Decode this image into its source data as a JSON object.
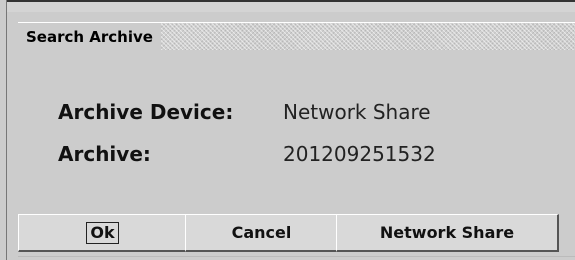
{
  "dialog": {
    "title": "Search Archive"
  },
  "fields": [
    {
      "label": "Archive Device:",
      "value": "Network Share"
    },
    {
      "label": "Archive:",
      "value": "201209251532"
    }
  ],
  "buttons": {
    "ok_label": "Ok",
    "cancel_label": "Cancel",
    "network_share_label": "Network Share"
  },
  "colors": {
    "background": "#cccccc",
    "title_pattern": "#cfcfcf",
    "text": "#111111"
  }
}
